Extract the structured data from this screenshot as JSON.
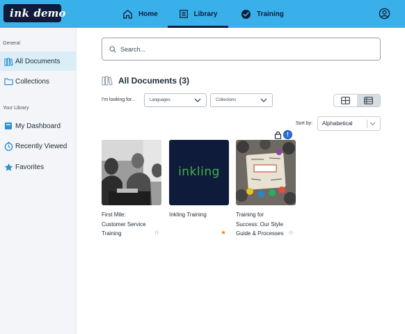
{
  "header": {
    "logo_text_ink": "ink",
    "logo_text_demo": "demo",
    "nav": [
      {
        "label": "Home",
        "icon": "home-icon"
      },
      {
        "label": "Library",
        "icon": "library-icon",
        "active": true
      },
      {
        "label": "Training",
        "icon": "check-badge-icon"
      }
    ],
    "profile_icon": "user-circle-icon"
  },
  "sidebar": {
    "general_heading": "General",
    "general_items": [
      {
        "label": "All Documents",
        "icon": "library-icon",
        "active": true
      },
      {
        "label": "Collections",
        "icon": "folder-icon"
      }
    ],
    "library_heading": "Your Library",
    "library_items": [
      {
        "label": "My Dashboard",
        "icon": "dashboard-icon"
      },
      {
        "label": "Recently Viewed",
        "icon": "clock-icon"
      },
      {
        "label": "Favorites",
        "icon": "star-icon"
      }
    ]
  },
  "main": {
    "search_placeholder": "Search...",
    "section_title": "All Documents (3)",
    "filter_label": "I'm looking for...",
    "languages_placeholder": "Languages",
    "collections_placeholder": "Collections",
    "sort_label": "Sort by:",
    "sort_value": "Alphabetical",
    "cards": [
      {
        "title": "First Mile: Customer Service Training",
        "favorite": false
      },
      {
        "title": "Inkling Training",
        "favorite": true,
        "thumb_text": "inkling"
      },
      {
        "title": "Training for Success: Our Style Guide & Processes",
        "favorite": false
      }
    ]
  },
  "colors": {
    "topbar": "#3ab0ea",
    "navy": "#0d1b3a",
    "star_on": "#e58a1f",
    "sidebar_active": "#dbeef8",
    "inkling_green": "#46b34a"
  }
}
